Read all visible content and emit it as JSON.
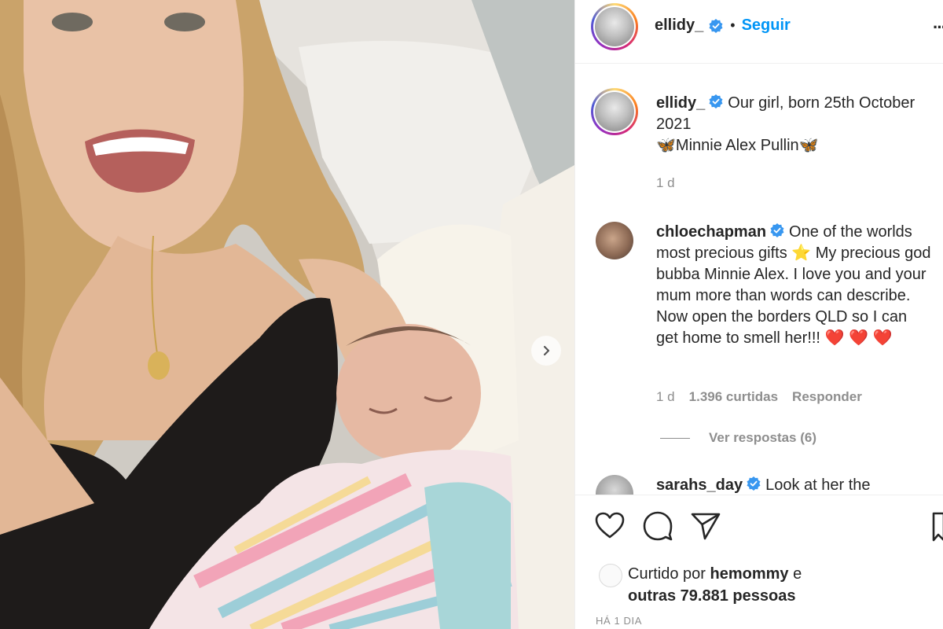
{
  "post": {
    "username": "ellidy_",
    "follow_label": "Seguir",
    "dot": "•",
    "more_label": "···"
  },
  "caption": {
    "username": "ellidy_",
    "text_line1": "Our girl, born 25th October 2021",
    "text_line2": "🦋Minnie Alex Pullin🦋",
    "time": "1 d"
  },
  "comments": [
    {
      "username": "chloechapman",
      "text": "One of the worlds most precious gifts ⭐ My precious god bubba Minnie Alex. I love you and your mum more than words can describe. Now open the borders QLD so I can get home to smell her!!! ❤️ ❤️ ❤️",
      "time": "1 d",
      "likes": "1.396 curtidas",
      "reply_label": "Responder",
      "view_replies": "Ver respostas (6)"
    },
    {
      "username": "sarahs_day",
      "text": "Look at her the"
    }
  ],
  "likes": {
    "prefix": "Curtido por",
    "liker": "hemommy",
    "conj": "e",
    "others": "outras 79.881 pessoas"
  },
  "date": "HÁ 1 DIA",
  "icons": {
    "like": "heart-icon",
    "comment": "comment-icon",
    "share": "share-icon",
    "save": "bookmark-icon",
    "next": "chevron-right-icon",
    "verified": "verified-badge-icon"
  },
  "colors": {
    "link": "#0095f6",
    "verified": "#3897f0",
    "secondary_text": "#8e8e8e",
    "primary_text": "#262626"
  }
}
